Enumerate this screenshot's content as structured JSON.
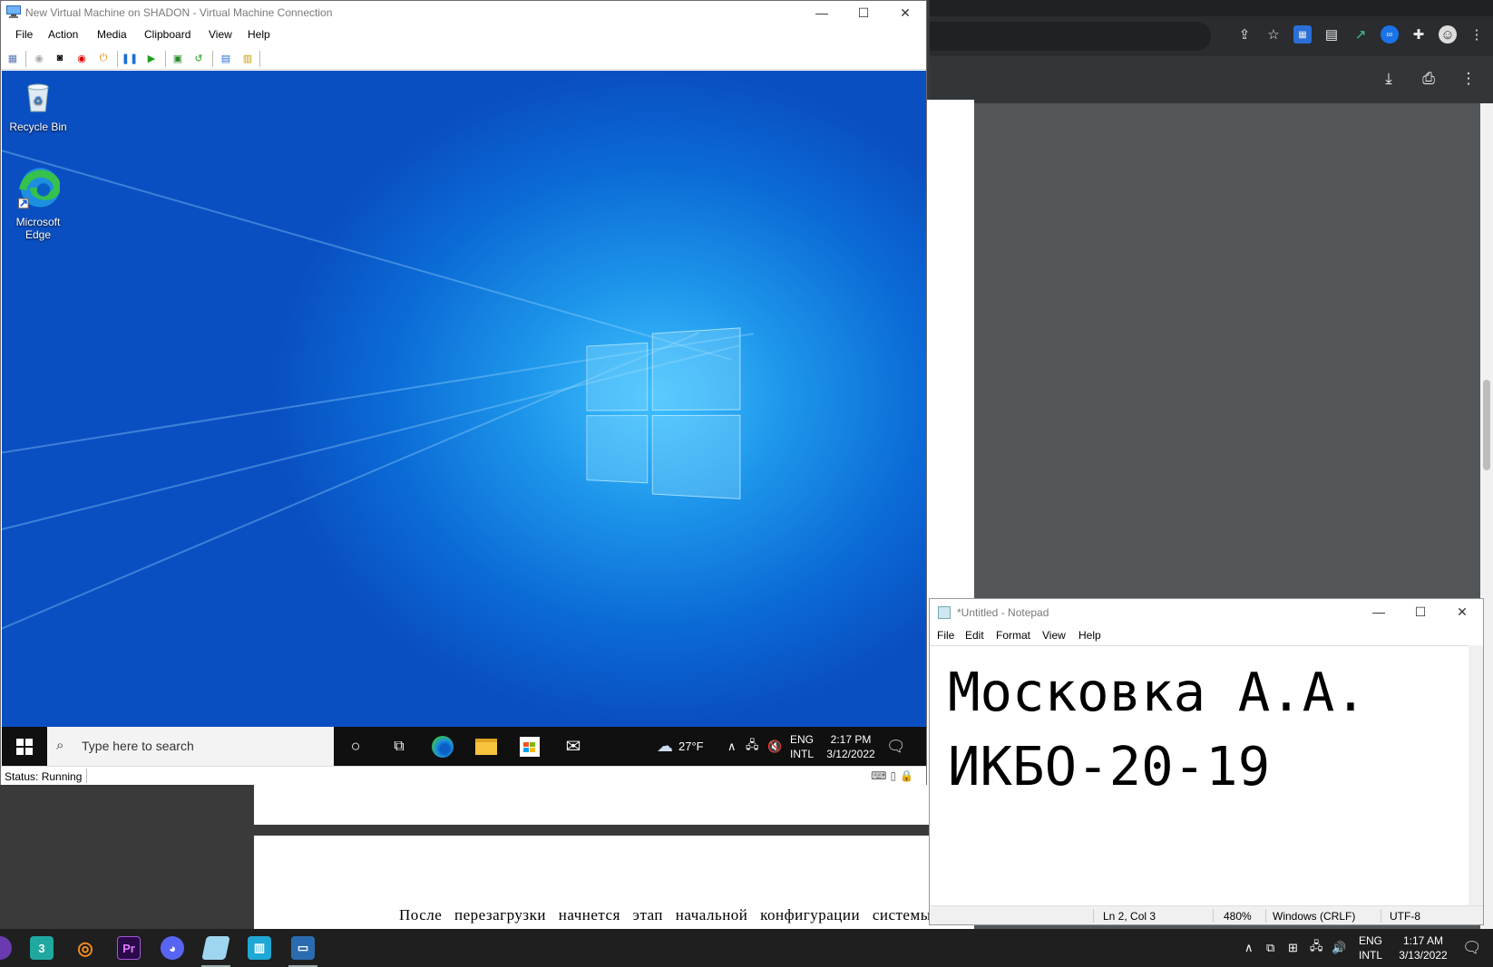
{
  "vm_window": {
    "title": "New Virtual Machine on SHADON - Virtual Machine Connection",
    "menu": [
      "File",
      "Action",
      "Media",
      "Clipboard",
      "View",
      "Help"
    ],
    "status": "Status: Running"
  },
  "desktop": {
    "icons": [
      {
        "label": "Recycle Bin",
        "icon": "recycle-bin-icon"
      },
      {
        "label": "Microsoft Edge",
        "icon": "edge-icon"
      }
    ]
  },
  "vm_taskbar": {
    "search_placeholder": "Type here to search",
    "weather": "27°F",
    "lang_top": "ENG",
    "lang_bottom": "INTL",
    "time": "2:17 PM",
    "date": "3/12/2022"
  },
  "document": {
    "paragraph": "После перезагрузки начнется этап начальной конфигурации системы."
  },
  "notepad": {
    "title": "*Untitled - Notepad",
    "menu": [
      "File",
      "Edit",
      "Format",
      "View",
      "Help"
    ],
    "line1": "Московка А.А.",
    "line2": "ИКБО-20-19",
    "status_position": "Ln 2, Col 3",
    "status_zoom": "480%",
    "status_eol": "Windows (CRLF)",
    "status_encoding": "UTF-8"
  },
  "host_taskbar": {
    "lang_top": "ENG",
    "lang_bottom": "INTL",
    "time": "1:17 AM",
    "date": "3/13/2022"
  },
  "colors": {
    "desktop_accent": "#0b6bd6",
    "taskbar": "#101010"
  }
}
